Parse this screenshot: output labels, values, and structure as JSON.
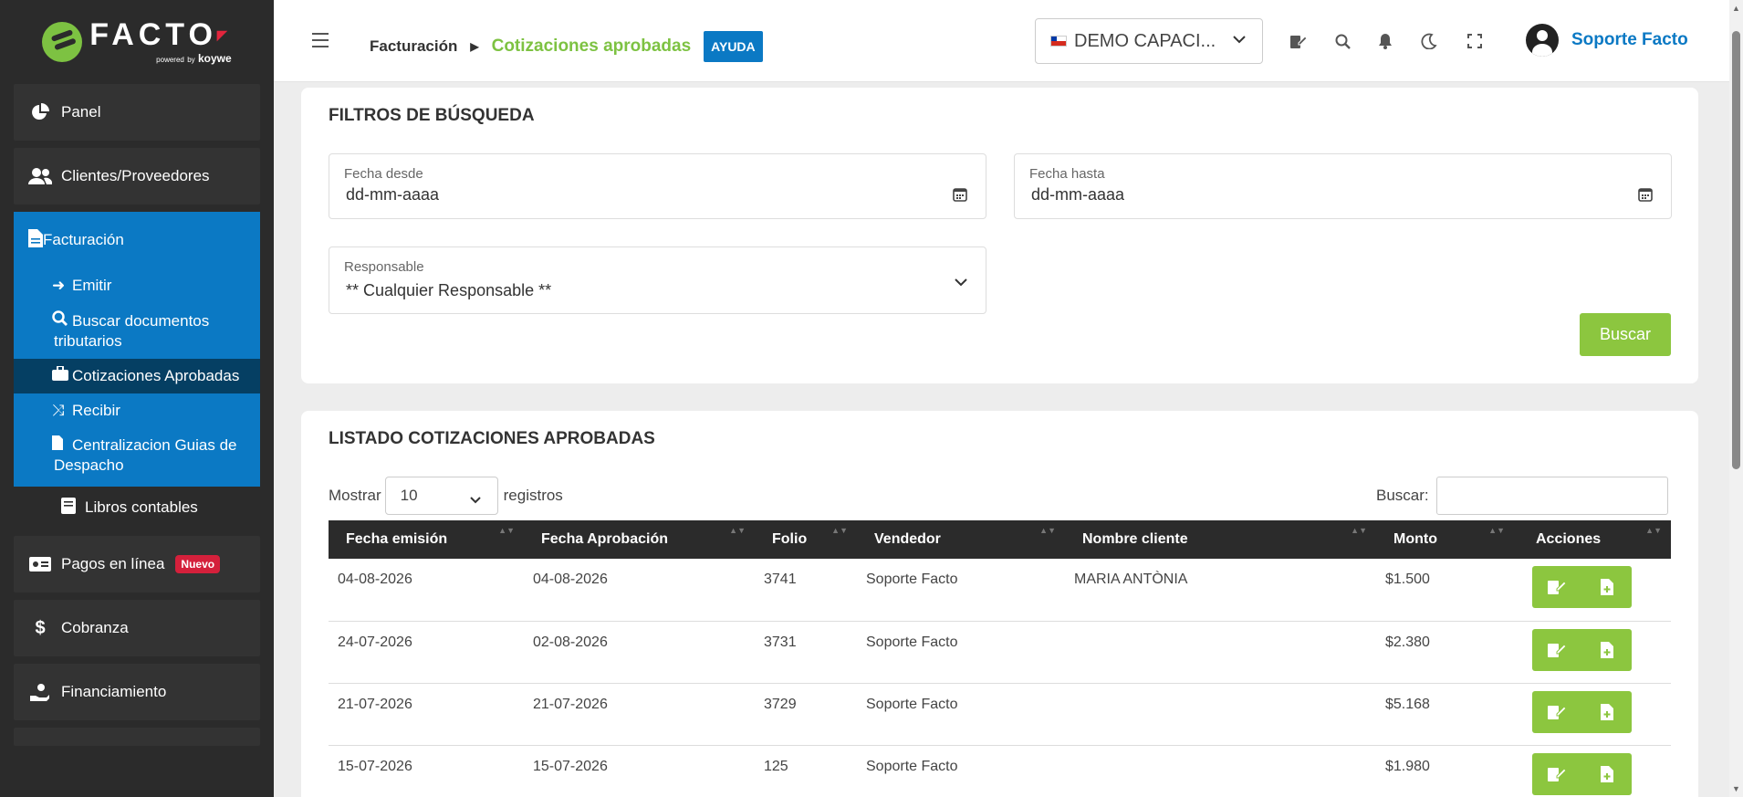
{
  "brand": {
    "name": "FACTO",
    "sub_powered": "powered",
    "sub_by": "by",
    "sub_company": "koywe"
  },
  "sidebar": {
    "panel": "Panel",
    "clientes": "Clientes/Proveedores",
    "facturacion": "Facturación",
    "emitir": "Emitir",
    "buscar_docs": "Buscar documentos tributarios",
    "cotizaciones": "Cotizaciones Aprobadas",
    "recibir": "Recibir",
    "centralizacion": "Centralizacion Guias de Despacho",
    "libros": "Libros contables",
    "pagos": "Pagos en línea",
    "pagos_badge": "Nuevo",
    "cobranza": "Cobranza",
    "financiamiento": "Financiamiento"
  },
  "header": {
    "breadcrumb_parent": "Facturación",
    "breadcrumb_current": "Cotizaciones aprobadas",
    "help": "AYUDA",
    "company": "DEMO CAPACI...",
    "user": "Soporte Facto"
  },
  "filters": {
    "title": "FILTROS DE BÚSQUEDA",
    "fecha_desde_label": "Fecha desde",
    "fecha_desde_value": "dd-mm-aaaa",
    "fecha_hasta_label": "Fecha hasta",
    "fecha_hasta_value": "dd-mm-aaaa",
    "responsable_label": "Responsable",
    "responsable_value": "** Cualquier Responsable **",
    "buscar_button": "Buscar"
  },
  "listado": {
    "title": "LISTADO COTIZACIONES APROBADAS",
    "mostrar": "Mostrar",
    "page_size": "10",
    "registros": "registros",
    "buscar_label": "Buscar:",
    "columns": [
      "Fecha emisión",
      "Fecha Aprobación",
      "Folio",
      "Vendedor",
      "Nombre cliente",
      "Monto",
      "Acciones"
    ],
    "rows": [
      {
        "emision": "04-08-2026",
        "aprobacion": "04-08-2026",
        "folio": "3741",
        "vendedor": "Soporte Facto",
        "cliente": "MARIA ANTÒNIA",
        "monto": "$1.500"
      },
      {
        "emision": "24-07-2026",
        "aprobacion": "02-08-2026",
        "folio": "3731",
        "vendedor": "Soporte Facto",
        "cliente": "",
        "monto": "$2.380"
      },
      {
        "emision": "21-07-2026",
        "aprobacion": "21-07-2026",
        "folio": "3729",
        "vendedor": "Soporte Facto",
        "cliente": "",
        "monto": "$5.168"
      },
      {
        "emision": "15-07-2026",
        "aprobacion": "15-07-2026",
        "folio": "125",
        "vendedor": "Soporte Facto",
        "cliente": "",
        "monto": "$1.980"
      }
    ]
  },
  "colors": {
    "accent_green": "#8cc63f",
    "accent_blue": "#0b79c4",
    "sidebar_bg": "#2b2b2b"
  }
}
